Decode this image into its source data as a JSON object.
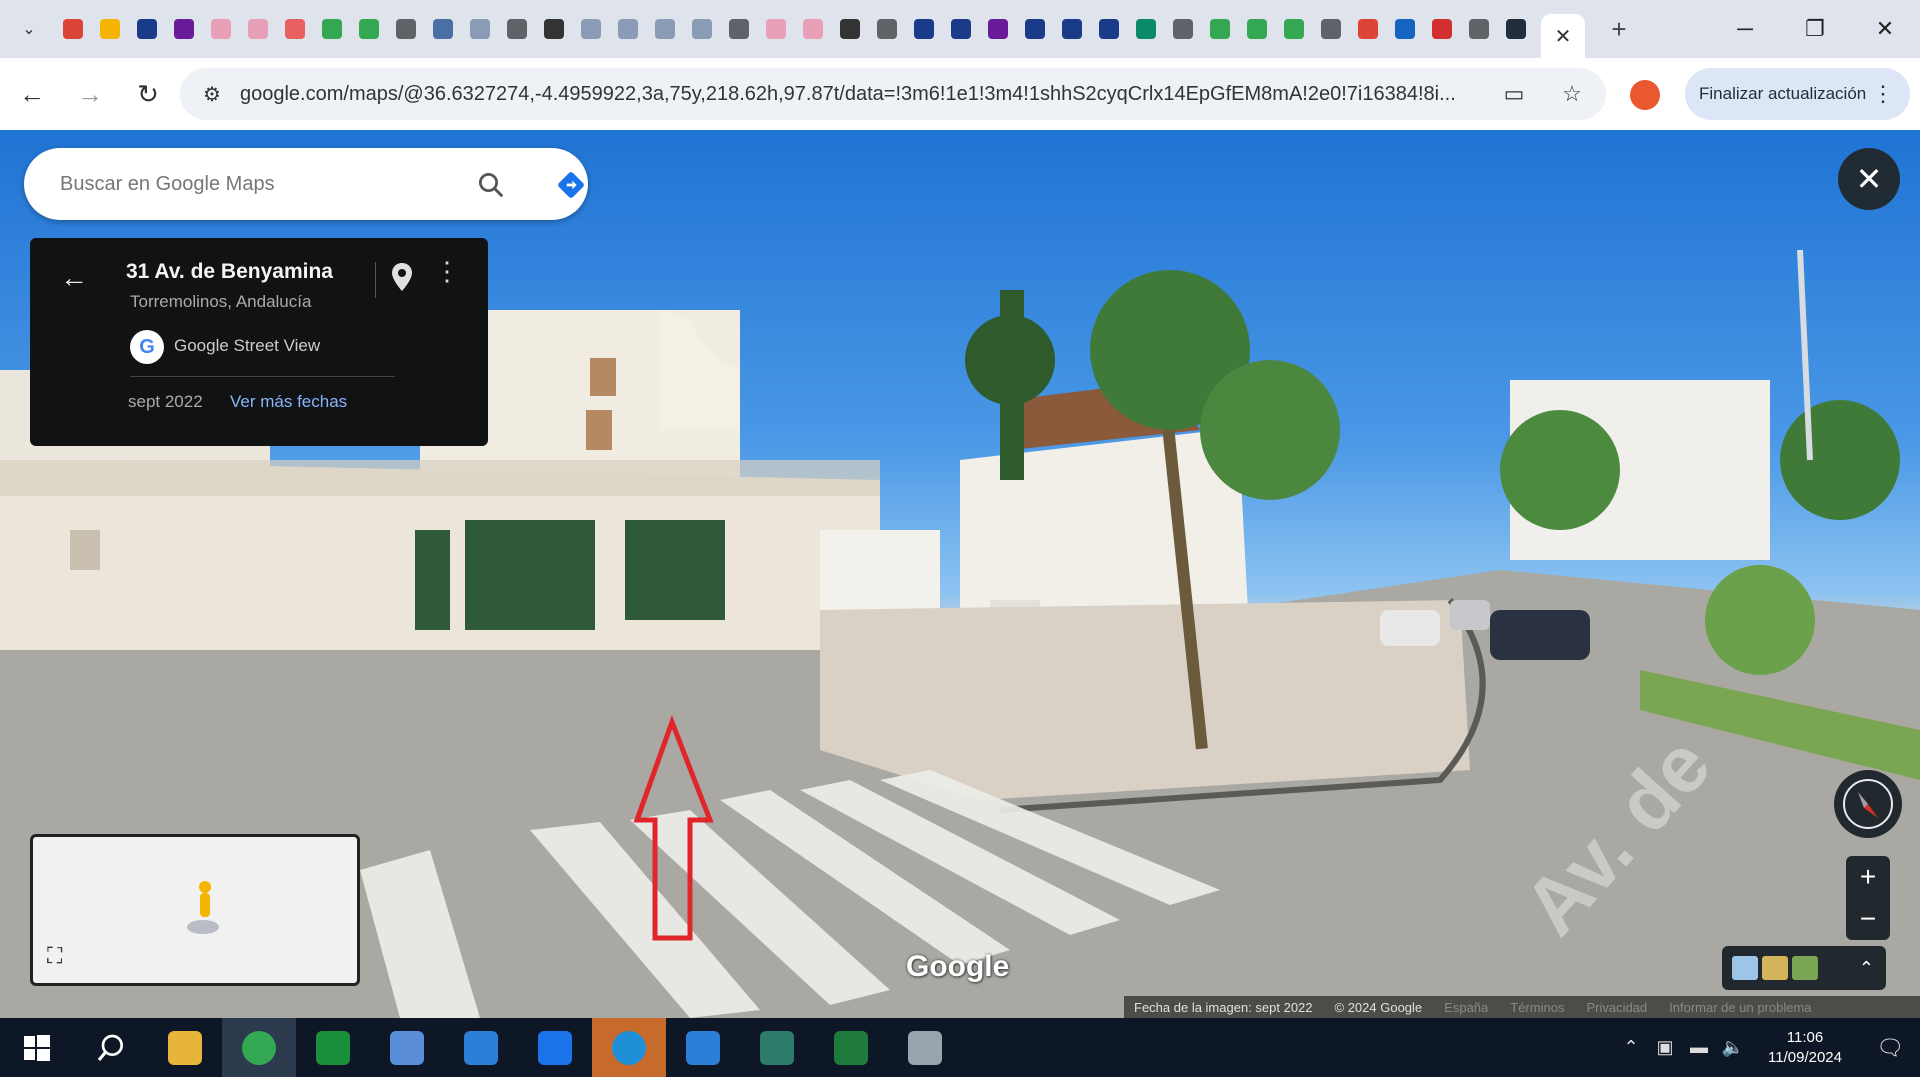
{
  "browser": {
    "url": "google.com/maps/@36.6327274,-4.4959922,3a,75y,218.62h,97.87t/data=!3m6!1e1!3m4!1shhS2cyqCrlx14EpGfEM8mA!2e0!7i16384!8i...",
    "update_button_label": "Finalizar actualización",
    "tab_icon_colors": [
      "#db4437",
      "#f4b400",
      "#1a3a8a",
      "#6a1b9a",
      "#e8a0b8",
      "#e8a0b8",
      "#e86060",
      "#34a853",
      "#34a853",
      "#5f6368",
      "#4a6fa5",
      "#8a9bb5",
      "#5f6368",
      "#333333",
      "#8a9bb5",
      "#8a9bb5",
      "#8a9bb5",
      "#8a9bb5",
      "#5f6368",
      "#e8a0b8",
      "#e8a0b8",
      "#333333",
      "#5f6368",
      "#1a3a8a",
      "#1a3a8a",
      "#6a1b9a",
      "#1a3a8a",
      "#1a3a8a",
      "#1a3a8a",
      "#0b8a6a",
      "#5f6368",
      "#34a853",
      "#34a853",
      "#34a853",
      "#5f6368",
      "#db4437",
      "#1565c0",
      "#d32f2f",
      "#5f6368",
      "#1f2d3d"
    ]
  },
  "maps": {
    "search_placeholder": "Buscar en Google Maps",
    "place": {
      "address": "31 Av. de Benyamina",
      "city": "Torremolinos, Andalucía",
      "source": "Google Street View",
      "date": "sept 2022",
      "more_dates": "Ver más fechas"
    },
    "watermark": "Google",
    "footer": {
      "image_date": "Fecha de la imagen: sept 2022",
      "copyright": "© 2024 Google",
      "country": "España",
      "terms": "Términos",
      "privacy": "Privacidad",
      "report": "Informar de un problema"
    }
  },
  "taskbar": {
    "time": "11:06",
    "date": "11/09/2024",
    "app_colors": [
      "#e7b43c",
      "#34a853",
      "#1a8f3c",
      "#5a8ed8",
      "#2b7fd6",
      "#1a73e8",
      "#1f8fd8",
      "#2b7fd6",
      "#2e7d6a",
      "#1e7b3c",
      "#9aa4ad"
    ]
  }
}
